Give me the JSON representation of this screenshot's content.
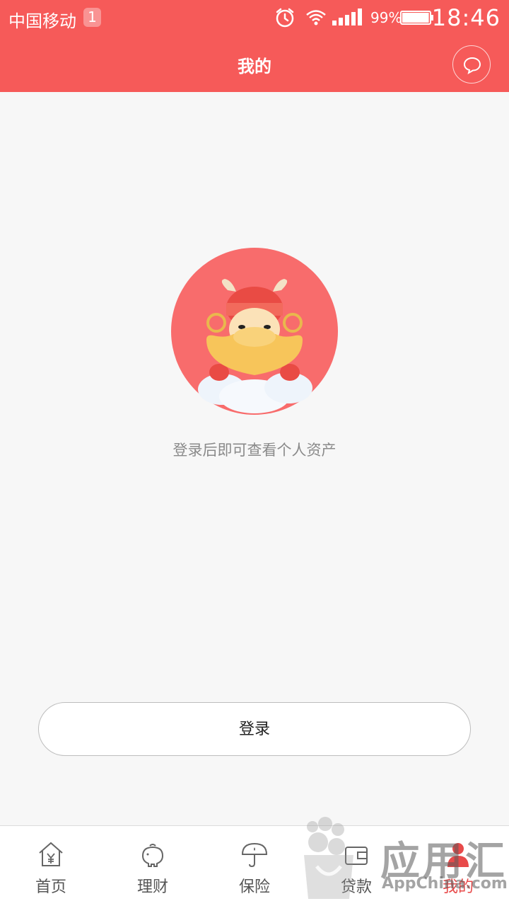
{
  "status_bar": {
    "carrier": "中国移动",
    "notification_count": "1",
    "battery_percent": "99%",
    "time": "18:46",
    "battery_level": 0.99
  },
  "header": {
    "title": "我的",
    "message_icon": "chat-bubble-icon"
  },
  "main": {
    "avatar_icon": "mascot-ox-god-of-wealth-icon",
    "hint": "登录后即可查看个人资产",
    "login_label": "登录"
  },
  "tabbar": {
    "items": [
      {
        "label": "首页",
        "icon": "home-yen-icon"
      },
      {
        "label": "理财",
        "icon": "piggy-bank-icon"
      },
      {
        "label": "保险",
        "icon": "umbrella-icon"
      },
      {
        "label": "贷款",
        "icon": "wallet-icon"
      },
      {
        "label": "我的",
        "icon": "user-icon"
      }
    ],
    "active_index": 4
  },
  "watermark": {
    "text": "应用汇",
    "sub": "AppChina.com"
  },
  "colors": {
    "brand": "#f65a59",
    "active_tab": "#e84a4a",
    "background": "#f7f7f7"
  }
}
